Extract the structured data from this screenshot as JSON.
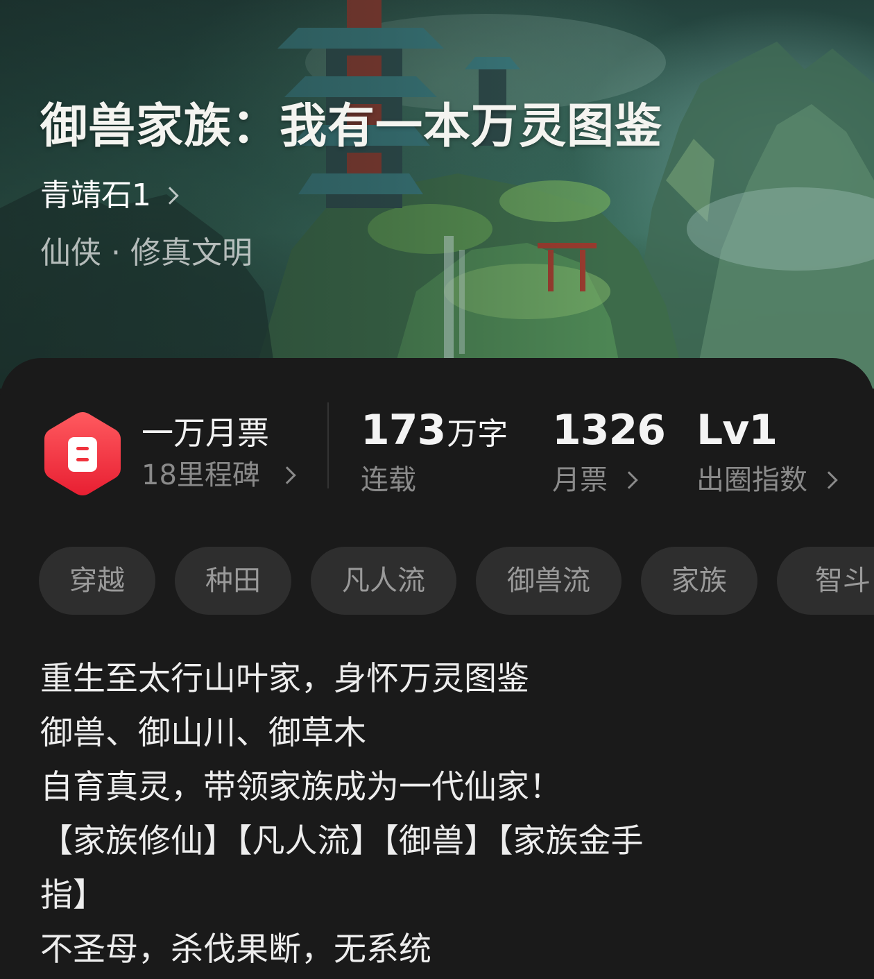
{
  "book": {
    "title": "御兽家族：我有一本万灵图鉴",
    "author": "青靖石1",
    "genre": "仙侠",
    "sub_genre": "修真文明",
    "genre_separator": "·"
  },
  "milestone": {
    "title": "一万月票",
    "subtitle": "18里程碑",
    "badge_color": "#f0323c",
    "icon": "ticket-icon"
  },
  "stats": {
    "word_count_num": "173",
    "word_count_unit": "万字",
    "word_count_label": "连载",
    "monthly_votes": "1326",
    "monthly_votes_label": "月票",
    "index_value": "Lv1",
    "index_label": "出圈指数"
  },
  "tags": [
    "穿越",
    "种田",
    "凡人流",
    "御兽流",
    "家族",
    "智斗"
  ],
  "synopsis": [
    "重生至太行山叶家，身怀万灵图鉴",
    "御兽、御山川、御草木",
    "自育真灵，带领家族成为一代仙家！",
    "【家族修仙】【凡人流】【御兽】【家族金手",
    "指】",
    "不圣母，杀伐果断，无系统"
  ],
  "colors": {
    "background": "#1a1a1a",
    "tag_background": "#2e2e2e",
    "muted_text": "#8a8a8a"
  }
}
